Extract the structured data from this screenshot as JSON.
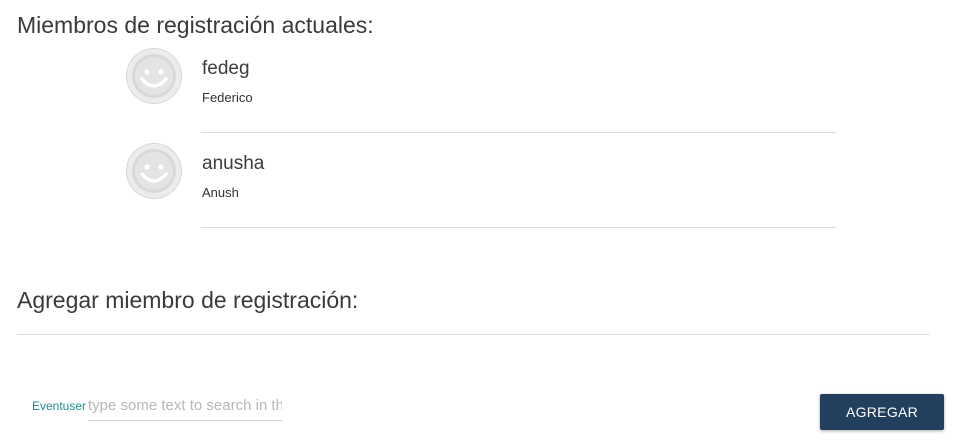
{
  "current_section": {
    "title": "Miembros de registración actuales:"
  },
  "members": [
    {
      "username": "fedeg",
      "display_name": "Federico",
      "avatar_icon": "smiley-face-icon"
    },
    {
      "username": "anusha",
      "display_name": "Anush",
      "avatar_icon": "smiley-face-icon"
    }
  ],
  "add_section": {
    "title": "Agregar miembro de registración:",
    "field_label": "Eventuser",
    "search_placeholder": "type some text to search in this field",
    "search_value": "",
    "add_button_label": "AGREGAR"
  },
  "colors": {
    "accent_label": "#1f8a8a",
    "button_bg": "#233f5e",
    "divider": "#dddddd"
  }
}
